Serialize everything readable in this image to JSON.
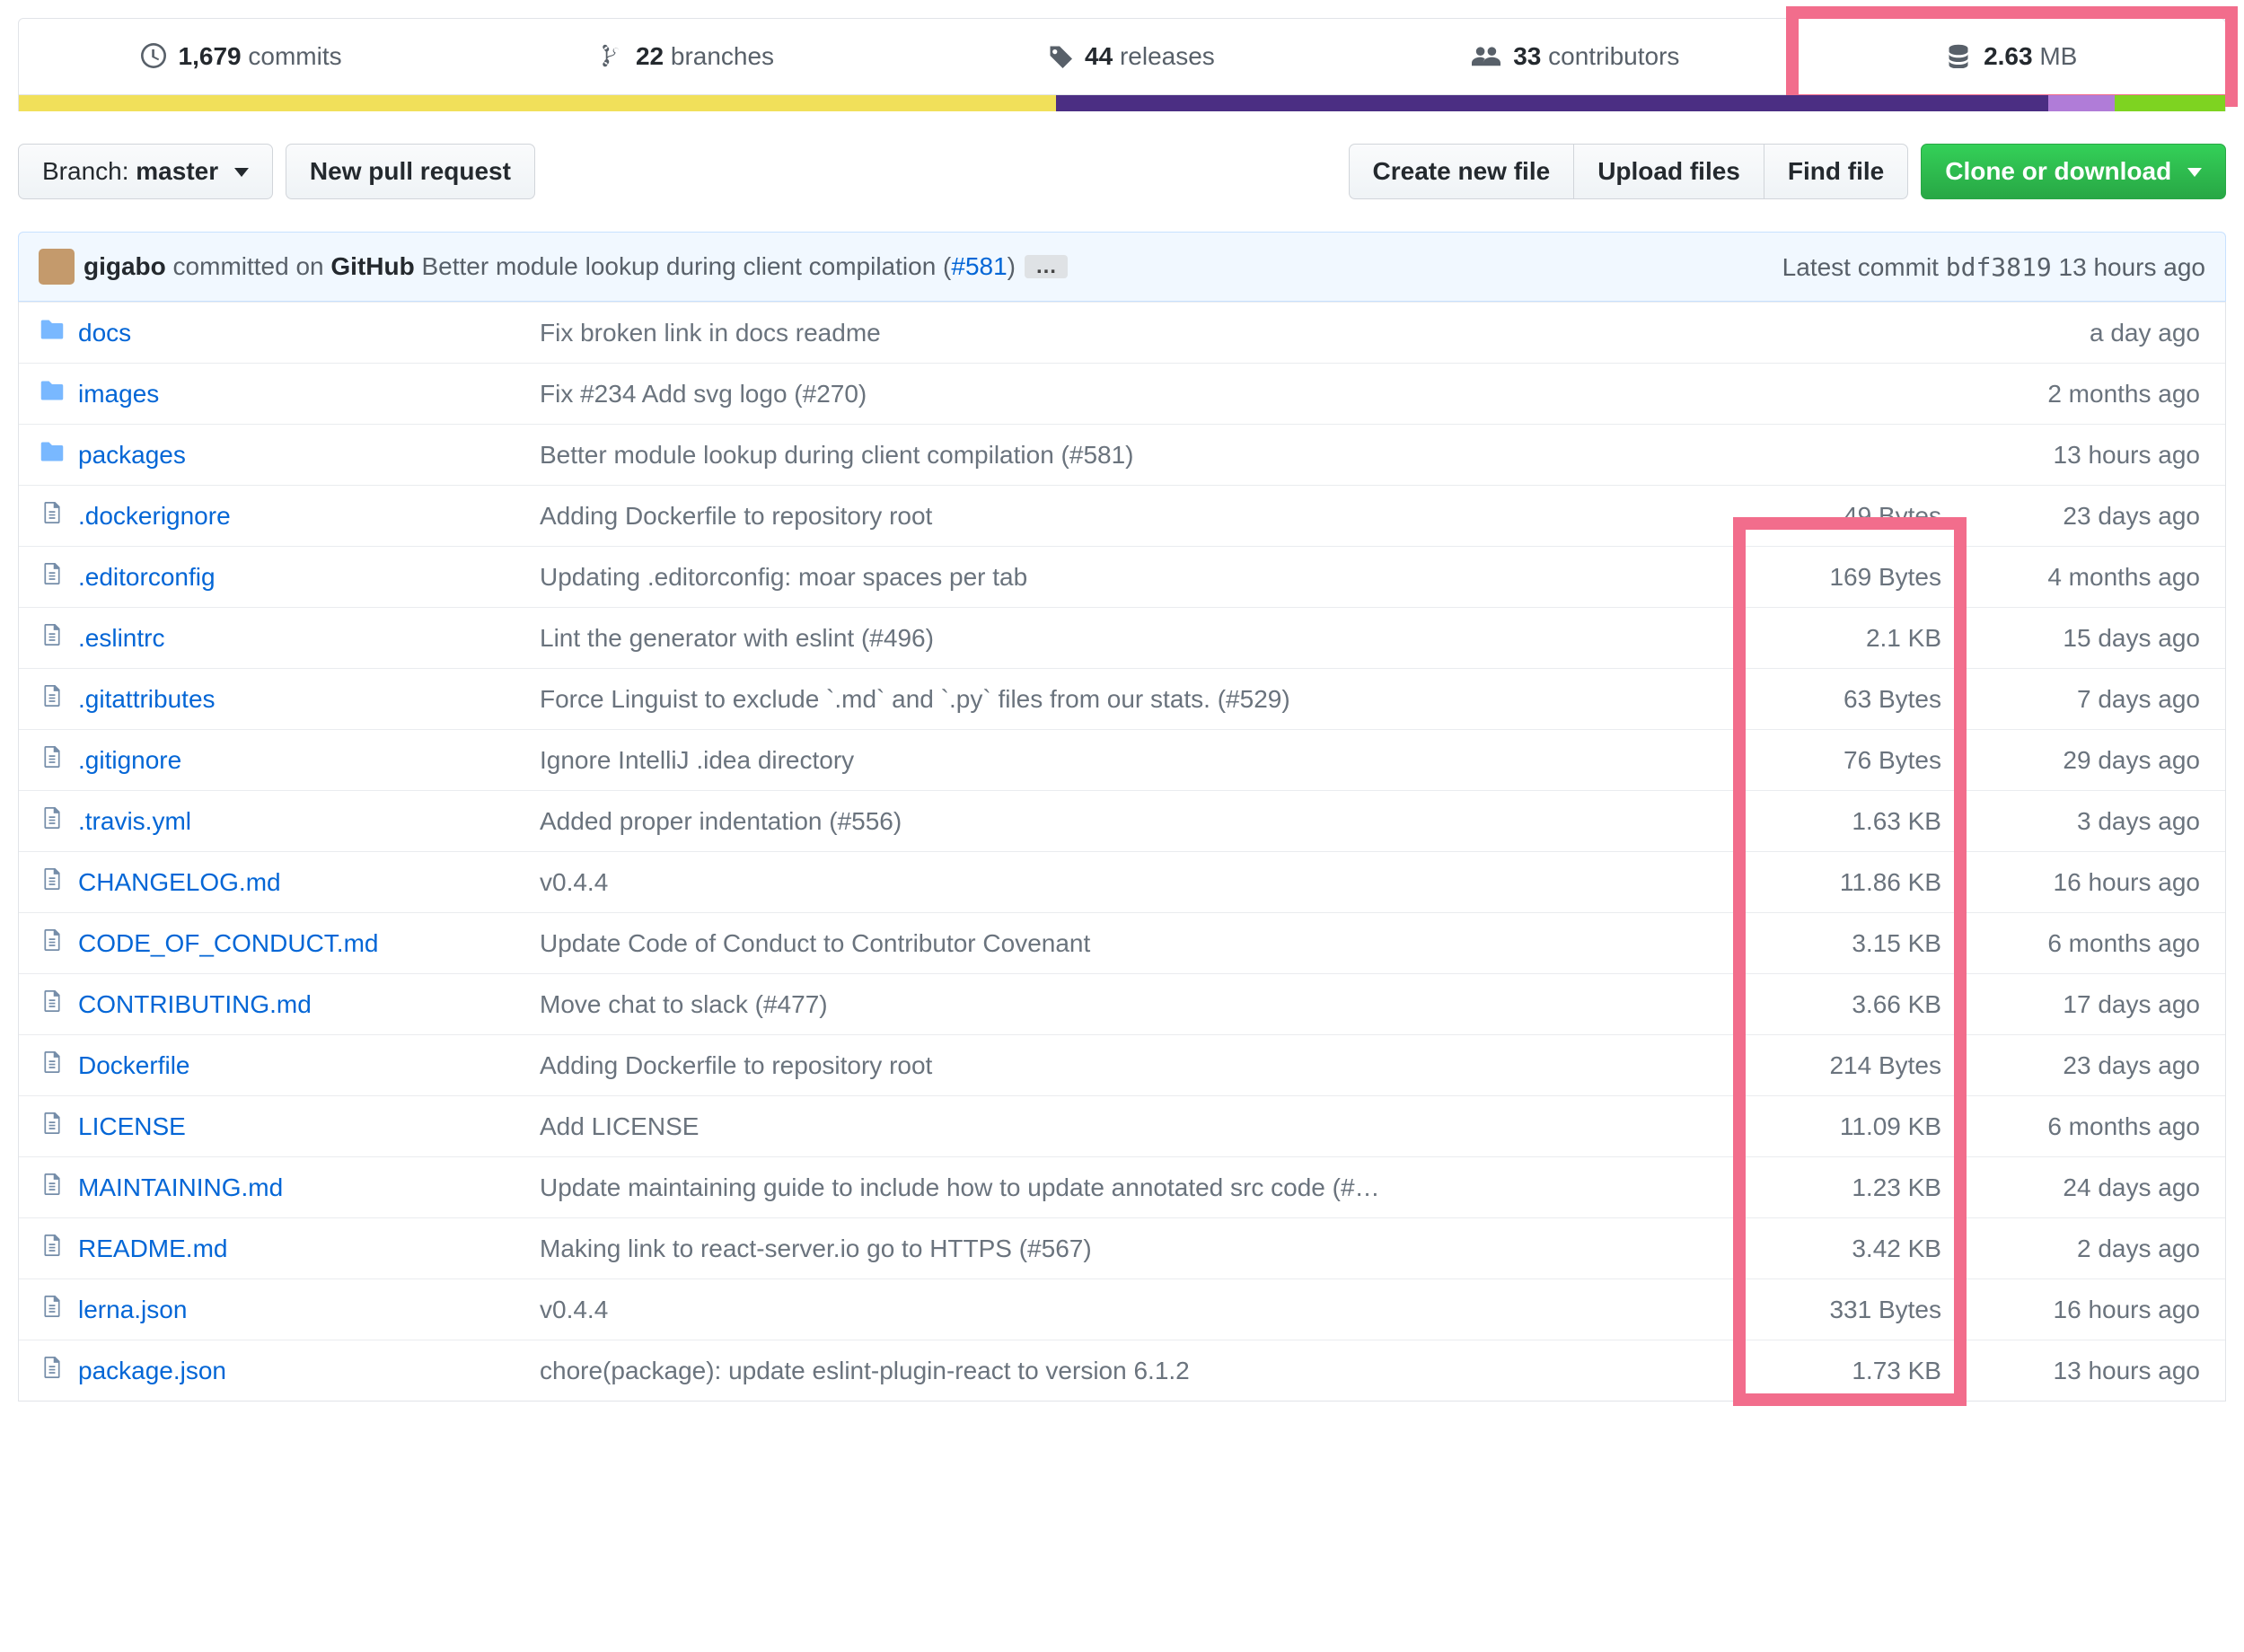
{
  "stats": {
    "commits": {
      "count": "1,679",
      "label": "commits"
    },
    "branches": {
      "count": "22",
      "label": "branches"
    },
    "releases": {
      "count": "44",
      "label": "releases"
    },
    "contributors": {
      "count": "33",
      "label": "contributors"
    },
    "size": {
      "value": "2.63",
      "unit": "MB"
    }
  },
  "languages": [
    {
      "color": "#f1e05a",
      "pct": 47
    },
    {
      "color": "#4b2e83",
      "pct": 45
    },
    {
      "color": "#b07cd8",
      "pct": 3
    },
    {
      "color": "#7ed321",
      "pct": 5
    }
  ],
  "toolbar": {
    "branch_label": "Branch:",
    "branch_value": "master",
    "new_pr": "New pull request",
    "create_file": "Create new file",
    "upload": "Upload files",
    "find": "Find file",
    "clone": "Clone or download"
  },
  "commit": {
    "author": "gigabo",
    "verb": "committed on",
    "source": "GitHub",
    "message": "Better module lookup during client compilation (",
    "pr": "#581",
    "message_close": ")",
    "latest_label": "Latest commit",
    "sha": "bdf3819",
    "age": "13 hours ago"
  },
  "files": [
    {
      "type": "dir",
      "name": "docs",
      "msg": "Fix broken link in docs readme",
      "size": "",
      "age": "a day ago"
    },
    {
      "type": "dir",
      "name": "images",
      "msg": "Fix #234 Add svg logo (#270)",
      "size": "",
      "age": "2 months ago"
    },
    {
      "type": "dir",
      "name": "packages",
      "msg": "Better module lookup during client compilation (#581)",
      "size": "",
      "age": "13 hours ago"
    },
    {
      "type": "file",
      "name": ".dockerignore",
      "msg": "Adding Dockerfile to repository root",
      "size": "49 Bytes",
      "age": "23 days ago"
    },
    {
      "type": "file",
      "name": ".editorconfig",
      "msg": "Updating .editorconfig: moar spaces per tab",
      "size": "169 Bytes",
      "age": "4 months ago"
    },
    {
      "type": "file",
      "name": ".eslintrc",
      "msg": "Lint the generator with eslint (#496)",
      "size": "2.1 KB",
      "age": "15 days ago"
    },
    {
      "type": "file",
      "name": ".gitattributes",
      "msg": "Force Linguist to exclude `.md` and `.py` files from our stats. (#529)",
      "size": "63 Bytes",
      "age": "7 days ago"
    },
    {
      "type": "file",
      "name": ".gitignore",
      "msg": "Ignore IntelliJ .idea directory",
      "size": "76 Bytes",
      "age": "29 days ago"
    },
    {
      "type": "file",
      "name": ".travis.yml",
      "msg": "Added proper indentation (#556)",
      "size": "1.63 KB",
      "age": "3 days ago"
    },
    {
      "type": "file",
      "name": "CHANGELOG.md",
      "msg": "v0.4.4",
      "size": "11.86 KB",
      "age": "16 hours ago"
    },
    {
      "type": "file",
      "name": "CODE_OF_CONDUCT.md",
      "msg": "Update Code of Conduct to Contributor Covenant",
      "size": "3.15 KB",
      "age": "6 months ago"
    },
    {
      "type": "file",
      "name": "CONTRIBUTING.md",
      "msg": "Move chat to slack (#477)",
      "size": "3.66 KB",
      "age": "17 days ago"
    },
    {
      "type": "file",
      "name": "Dockerfile",
      "msg": "Adding Dockerfile to repository root",
      "size": "214 Bytes",
      "age": "23 days ago"
    },
    {
      "type": "file",
      "name": "LICENSE",
      "msg": "Add LICENSE",
      "size": "11.09 KB",
      "age": "6 months ago"
    },
    {
      "type": "file",
      "name": "MAINTAINING.md",
      "msg": "Update maintaining guide to include how to update annotated src code (#…",
      "size": "1.23 KB",
      "age": "24 days ago"
    },
    {
      "type": "file",
      "name": "README.md",
      "msg": "Making link to react-server.io go to HTTPS (#567)",
      "size": "3.42 KB",
      "age": "2 days ago"
    },
    {
      "type": "file",
      "name": "lerna.json",
      "msg": "v0.4.4",
      "size": "331 Bytes",
      "age": "16 hours ago"
    },
    {
      "type": "file",
      "name": "package.json",
      "msg": "chore(package): update eslint-plugin-react to version 6.1.2",
      "size": "1.73 KB",
      "age": "13 hours ago"
    }
  ]
}
